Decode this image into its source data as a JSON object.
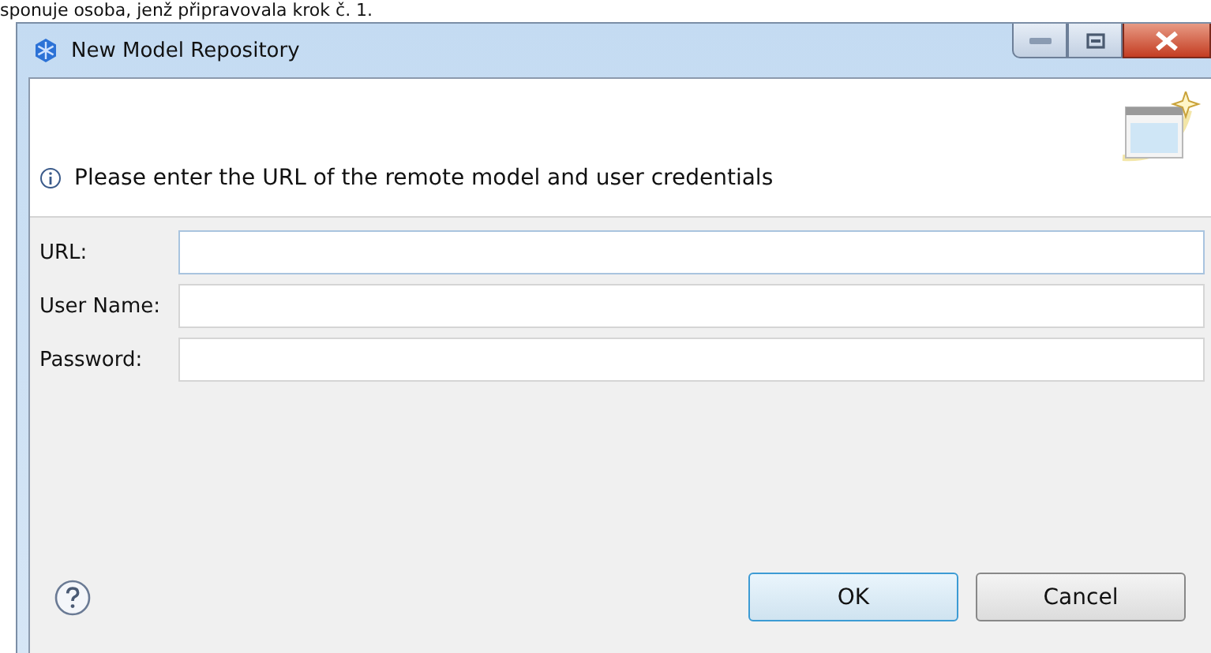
{
  "background_text": "sponuje osoba, jenž připravovala krok č. 1.",
  "window": {
    "title": "New Model Repository"
  },
  "header": {
    "message": "Please enter the URL of the remote model and user credentials"
  },
  "fields": [
    {
      "label": "URL:",
      "focused": true
    },
    {
      "label": "User Name:",
      "focused": false
    },
    {
      "label": "Password:",
      "focused": false
    }
  ],
  "buttons": [
    {
      "label": "OK",
      "default": true
    },
    {
      "label": "Cancel",
      "default": false
    }
  ]
}
